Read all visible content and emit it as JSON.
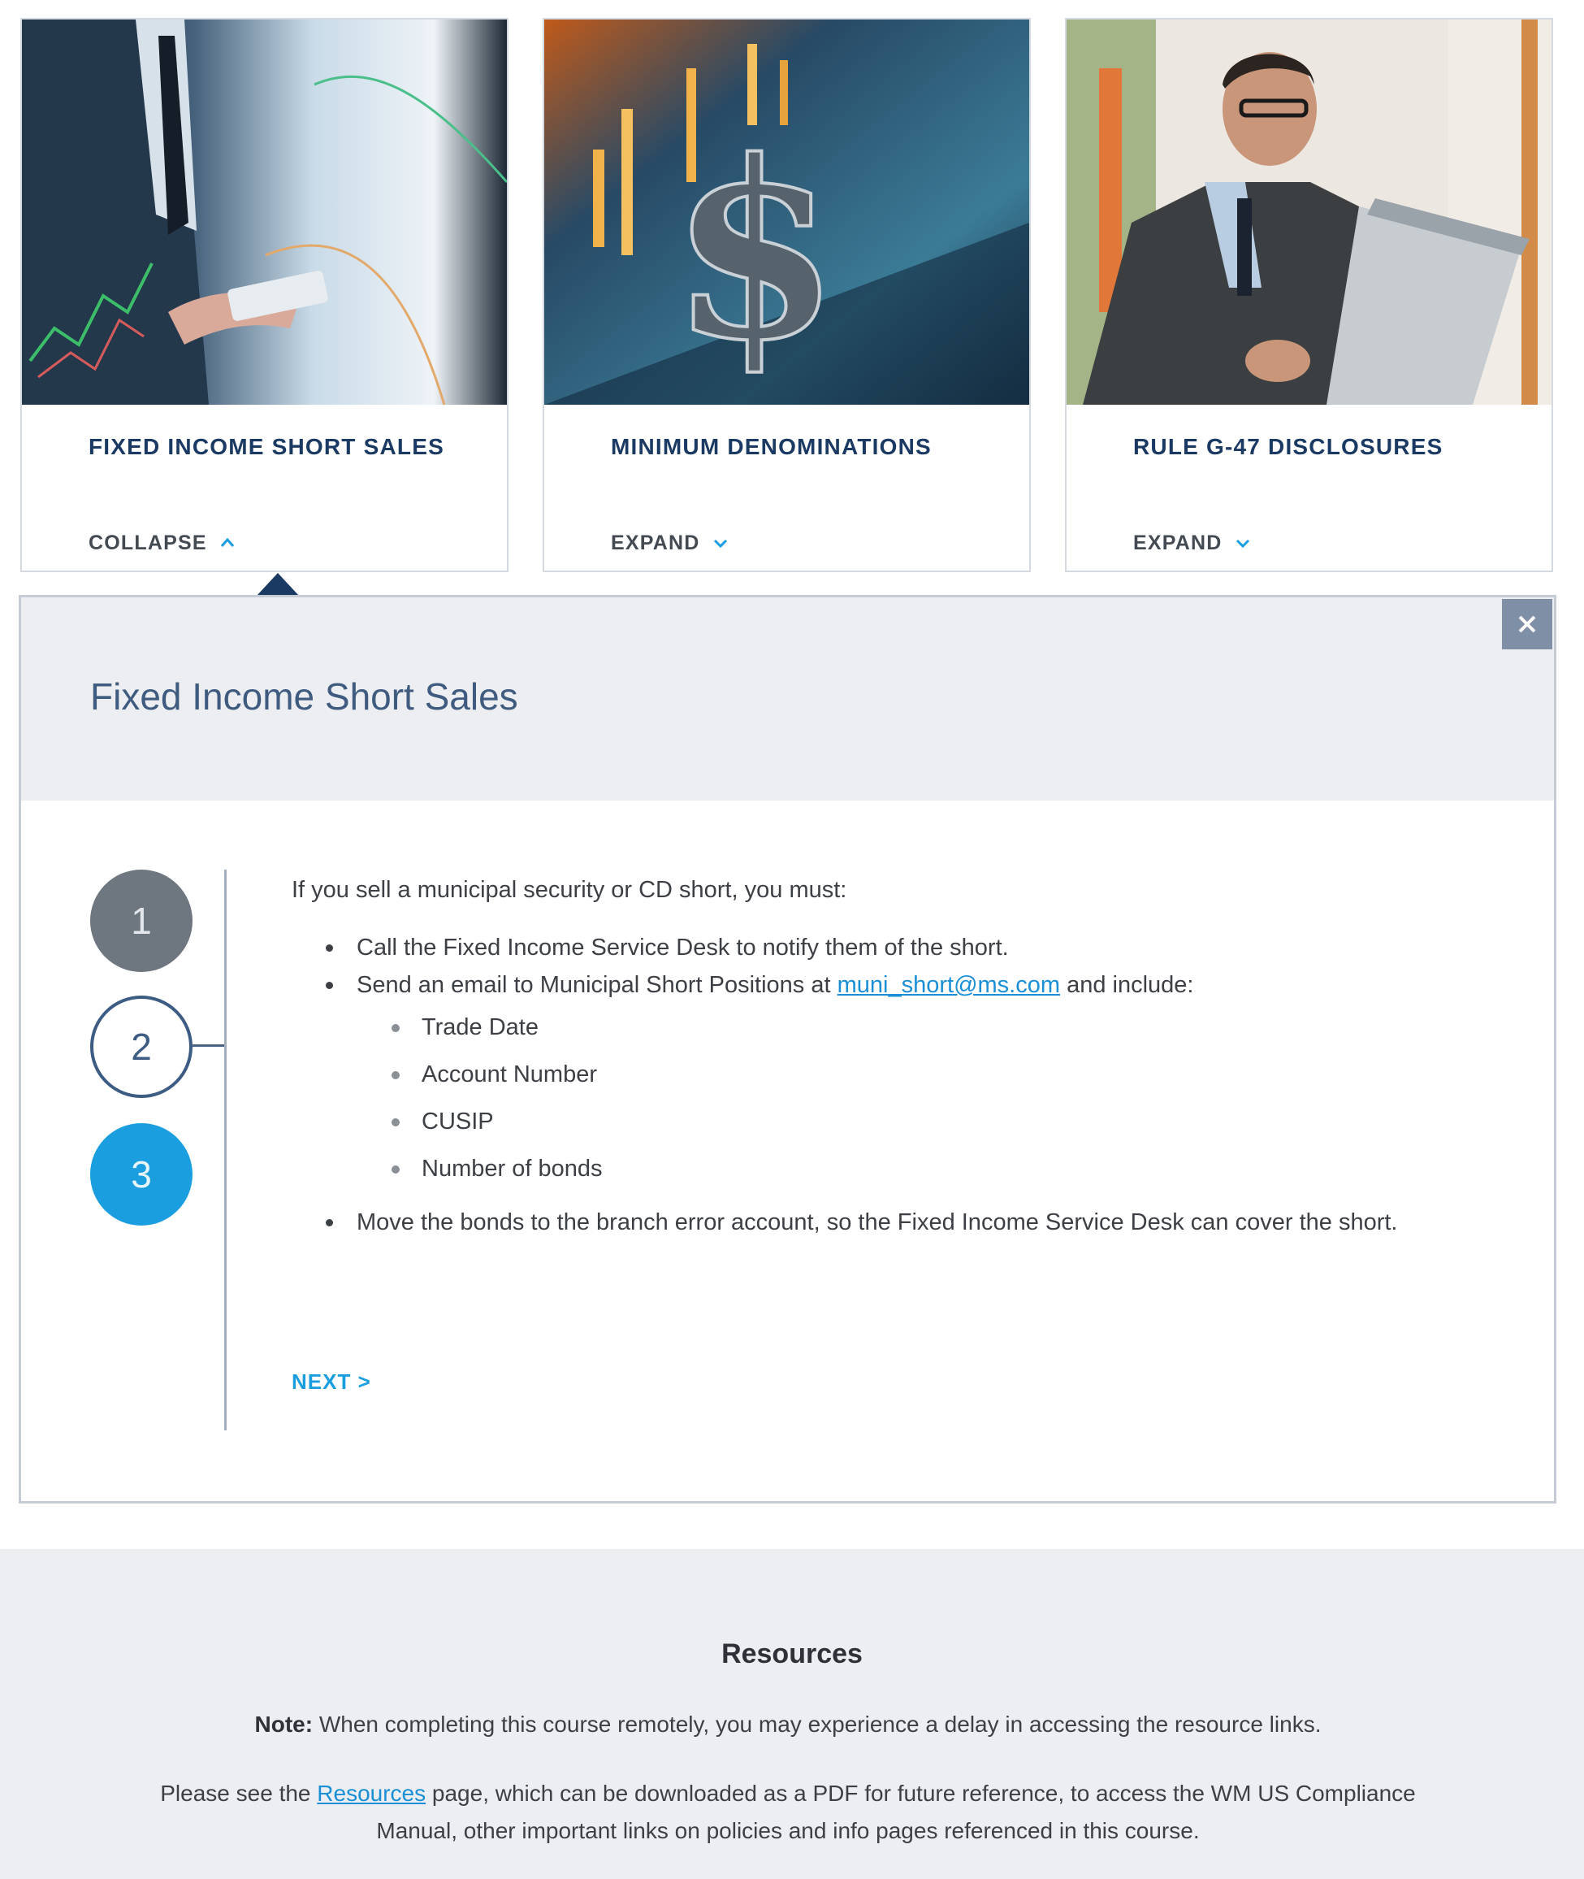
{
  "cards": [
    {
      "title": "FIXED INCOME SHORT SALES",
      "toggle_label": "COLLAPSE",
      "toggle_icon": "chevron-up-icon"
    },
    {
      "title": "MINIMUM DENOMINATIONS",
      "toggle_label": "EXPAND",
      "toggle_icon": "chevron-down-icon"
    },
    {
      "title": "RULE G-47 DISCLOSURES",
      "toggle_label": "EXPAND",
      "toggle_icon": "chevron-down-icon"
    }
  ],
  "panel": {
    "title": "Fixed Income Short Sales",
    "close_icon": "close-icon",
    "steps": [
      "1",
      "2",
      "3"
    ],
    "active_step": "2",
    "intro": "If you sell a municipal security or CD short, you must:",
    "bullet_1": "Call the Fixed Income Service Desk to notify them of the short.",
    "bullet_2_before": "Send an email to Municipal Short Positions at ",
    "bullet_2_email": "muni_short@ms.com",
    "bullet_2_after": " and include:",
    "sub_items": [
      "Trade Date",
      "Account Number",
      "CUSIP",
      "Number of bonds"
    ],
    "bullet_3": "Move the bonds to the branch error account, so the Fixed Income Service Desk can cover the short.",
    "next_label": "NEXT >"
  },
  "resources": {
    "title": "Resources",
    "note_label": "Note:",
    "note_text": " When completing this course remotely, you may experience a delay in accessing the resource links.",
    "para_before": "Please see the ",
    "para_link": "Resources",
    "para_after": " page, which can be downloaded as a PDF for future reference, to access the WM US Compliance Manual, other important links on policies and info pages referenced in this course."
  },
  "colors": {
    "accent_blue": "#1b9ee0",
    "navy": "#1b3a63",
    "panel_header_bg": "#eceef1",
    "link": "#1a8fd6"
  }
}
